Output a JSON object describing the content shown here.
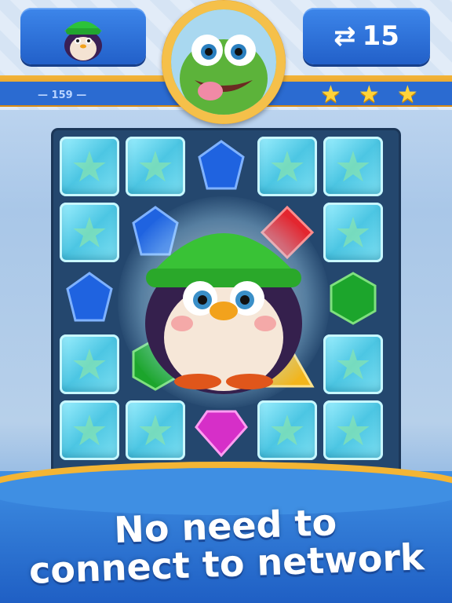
{
  "hud": {
    "moves_count": "15",
    "level_number": "— 159 —",
    "stars_earned": 3,
    "stars_total": 3
  },
  "board": {
    "tiles": [
      {
        "row": 0,
        "col": 0,
        "kind": "ice",
        "color": "#5fd3ea"
      },
      {
        "row": 0,
        "col": 1,
        "kind": "ice",
        "color": "#5fd3ea"
      },
      {
        "row": 0,
        "col": 2,
        "kind": "gem-blue",
        "color": "#1f63e0"
      },
      {
        "row": 0,
        "col": 3,
        "kind": "ice",
        "color": "#5fd3ea"
      },
      {
        "row": 0,
        "col": 4,
        "kind": "ice",
        "color": "#5fd3ea"
      },
      {
        "row": 1,
        "col": 0,
        "kind": "ice",
        "color": "#5fd3ea"
      },
      {
        "row": 1,
        "col": 1,
        "kind": "gem-blue",
        "color": "#1f63e0"
      },
      {
        "row": 1,
        "col": 3,
        "kind": "gem-red",
        "color": "#e3262f"
      },
      {
        "row": 1,
        "col": 4,
        "kind": "ice",
        "color": "#5fd3ea"
      },
      {
        "row": 2,
        "col": 0,
        "kind": "gem-blue",
        "color": "#1f63e0"
      },
      {
        "row": 2,
        "col": 4,
        "kind": "gem-green",
        "color": "#1ca52c"
      },
      {
        "row": 3,
        "col": 0,
        "kind": "ice",
        "color": "#5fd3ea"
      },
      {
        "row": 3,
        "col": 1,
        "kind": "gem-green",
        "color": "#1ca52c"
      },
      {
        "row": 3,
        "col": 3,
        "kind": "gem-yellow",
        "color": "#f2b51c"
      },
      {
        "row": 3,
        "col": 4,
        "kind": "ice",
        "color": "#5fd3ea"
      },
      {
        "row": 4,
        "col": 0,
        "kind": "ice",
        "color": "#5fd3ea"
      },
      {
        "row": 4,
        "col": 1,
        "kind": "ice",
        "color": "#5fd3ea"
      },
      {
        "row": 4,
        "col": 2,
        "kind": "gem-purple",
        "color": "#d62fc8"
      },
      {
        "row": 4,
        "col": 3,
        "kind": "ice",
        "color": "#5fd3ea"
      },
      {
        "row": 4,
        "col": 4,
        "kind": "ice",
        "color": "#5fd3ea"
      }
    ]
  },
  "promo": {
    "line1": "No need to",
    "line2": "connect to network"
  },
  "icons": {
    "swap": "swap-arrows-icon",
    "star": "star-icon",
    "player_avatar": "penguin-avatar-icon",
    "opponent_avatar": "dinosaur-avatar-icon"
  }
}
